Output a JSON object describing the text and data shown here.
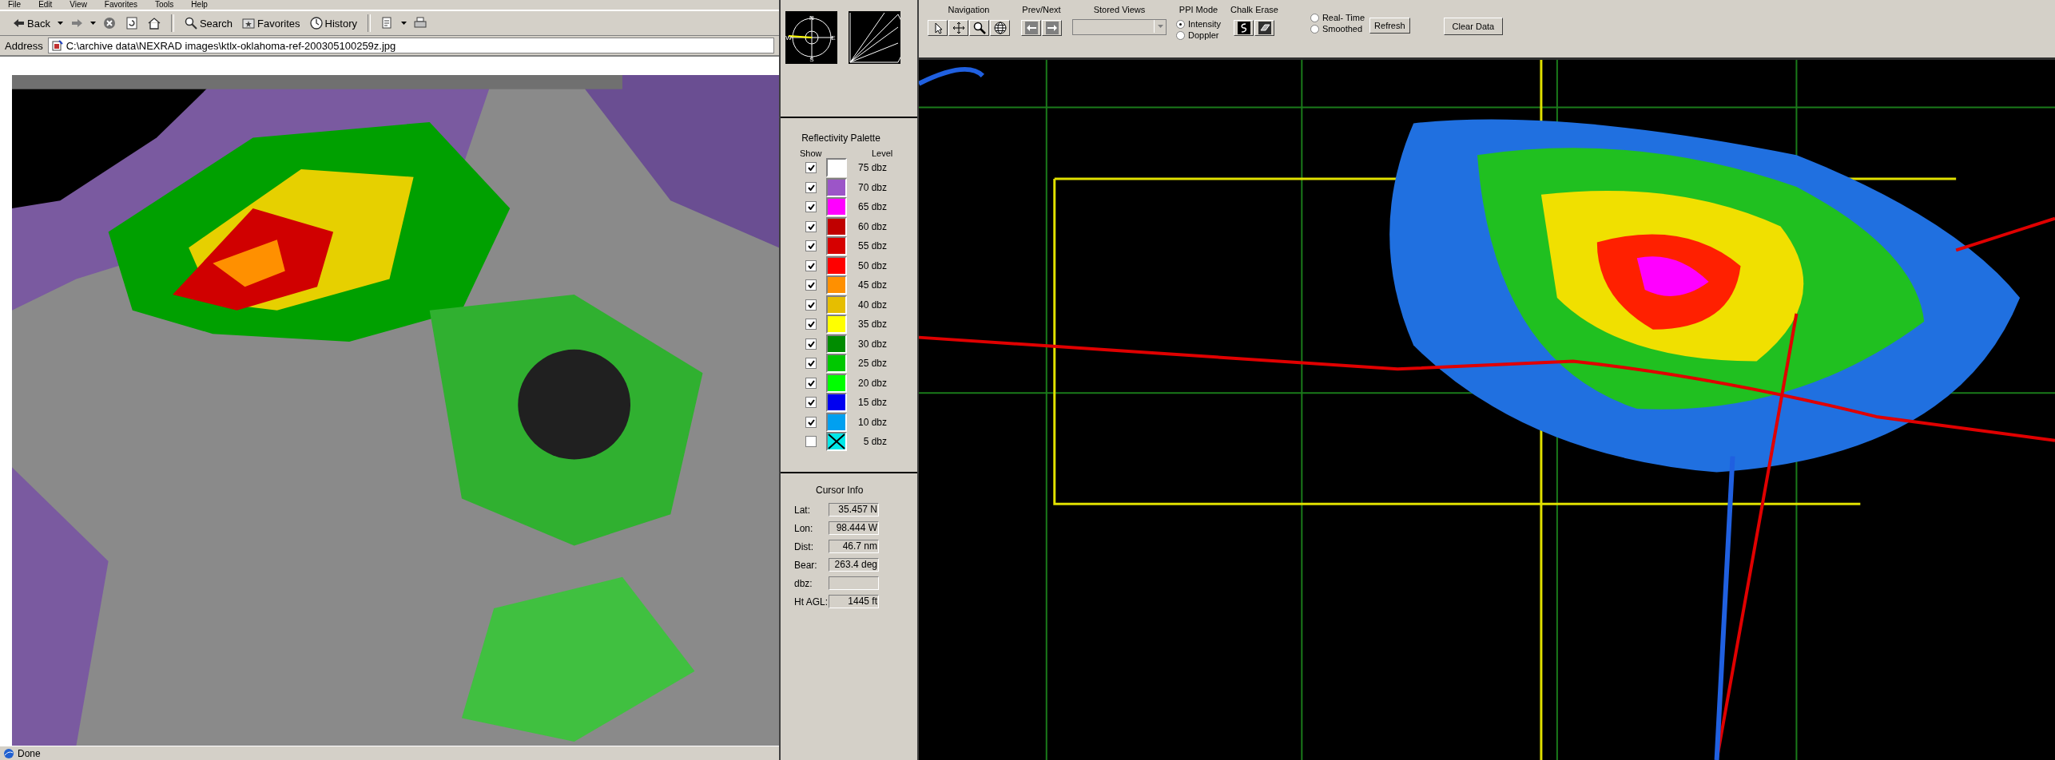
{
  "browser": {
    "menu": [
      "File",
      "Edit",
      "View",
      "Favorites",
      "Tools",
      "Help"
    ],
    "toolbar": [
      {
        "kind": "back",
        "label": "Back"
      },
      {
        "kind": "forward"
      },
      {
        "kind": "stop"
      },
      {
        "kind": "refresh"
      },
      {
        "kind": "home"
      },
      {
        "kind": "search",
        "label": "Search"
      },
      {
        "kind": "favorites",
        "label": "Favorites"
      },
      {
        "kind": "history",
        "label": "History"
      },
      {
        "kind": "edit"
      },
      {
        "kind": "print"
      }
    ],
    "address": {
      "label": "Address",
      "value": "C:\\archive data\\NEXRAD images\\ktlx-oklahoma-ref-200305100259z.jpg"
    },
    "status": "Done"
  },
  "compass": {
    "labels": [
      "N",
      "E",
      "S",
      "W"
    ]
  },
  "palette": {
    "title": "Reflectivity Palette",
    "col_show": "Show",
    "col_level": "Level",
    "rows": [
      {
        "label": "75 dbz",
        "checked": true,
        "color": "#ffffff",
        "crossed": false
      },
      {
        "label": "70 dbz",
        "checked": true,
        "color": "#9c55c8",
        "crossed": false
      },
      {
        "label": "65 dbz",
        "checked": true,
        "color": "#ff00ff",
        "crossed": false
      },
      {
        "label": "60 dbz",
        "checked": true,
        "color": "#c00000",
        "crossed": false
      },
      {
        "label": "55 dbz",
        "checked": true,
        "color": "#d60000",
        "crossed": false
      },
      {
        "label": "50 dbz",
        "checked": true,
        "color": "#ff0000",
        "crossed": false
      },
      {
        "label": "45 dbz",
        "checked": true,
        "color": "#ff9000",
        "crossed": false
      },
      {
        "label": "40 dbz",
        "checked": true,
        "color": "#e6be00",
        "crossed": false
      },
      {
        "label": "35 dbz",
        "checked": true,
        "color": "#ffff00",
        "crossed": false
      },
      {
        "label": "30 dbz",
        "checked": true,
        "color": "#008c00",
        "crossed": false
      },
      {
        "label": "25 dbz",
        "checked": true,
        "color": "#00c800",
        "crossed": false
      },
      {
        "label": "20 dbz",
        "checked": true,
        "color": "#00ff00",
        "crossed": false
      },
      {
        "label": "15 dbz",
        "checked": true,
        "color": "#0000f0",
        "crossed": false
      },
      {
        "label": "10 dbz",
        "checked": true,
        "color": "#00a0f0",
        "crossed": false
      },
      {
        "label": "5 dbz",
        "checked": false,
        "color": "#00e8e8",
        "crossed": true
      }
    ]
  },
  "cursor_info": {
    "title": "Cursor Info",
    "fields": [
      {
        "label": "Lat:",
        "value": "35.457 N"
      },
      {
        "label": "Lon:",
        "value": "98.444 W"
      },
      {
        "label": "Dist:",
        "value": "46.7 nm"
      },
      {
        "label": "Bear:",
        "value": "263.4 deg"
      },
      {
        "label": "dbz:"
      },
      {
        "label": "Ht AGL:",
        "value": "1445 ft"
      }
    ]
  },
  "toolbar": {
    "groups": [
      {
        "kind": "tools",
        "label": "Navigation",
        "tools": [
          {
            "kind": "pointer"
          },
          {
            "kind": "pan"
          },
          {
            "kind": "zoom"
          },
          {
            "kind": "globe"
          }
        ]
      },
      {
        "kind": "tools",
        "label": "Prev/Next",
        "tools": [
          {
            "kind": "left"
          },
          {
            "kind": "right"
          }
        ]
      },
      {
        "kind": "dropdown",
        "label": "Stored Views",
        "disabled": true
      },
      {
        "kind": "radios",
        "label": "PPI Mode",
        "options": [
          {
            "label": "Intensity",
            "selected": true
          },
          {
            "label": "Doppler",
            "selected": false
          }
        ]
      },
      {
        "kind": "tools",
        "label": "Chalk Erase",
        "tools": [
          {
            "kind": "chalk"
          },
          {
            "kind": "eraser"
          }
        ]
      }
    ],
    "mode": [
      {
        "label": "Real- Time",
        "selected": false
      },
      {
        "label": "Smoothed",
        "selected": false
      }
    ],
    "refresh": "Refresh",
    "clear": "Clear Data"
  }
}
